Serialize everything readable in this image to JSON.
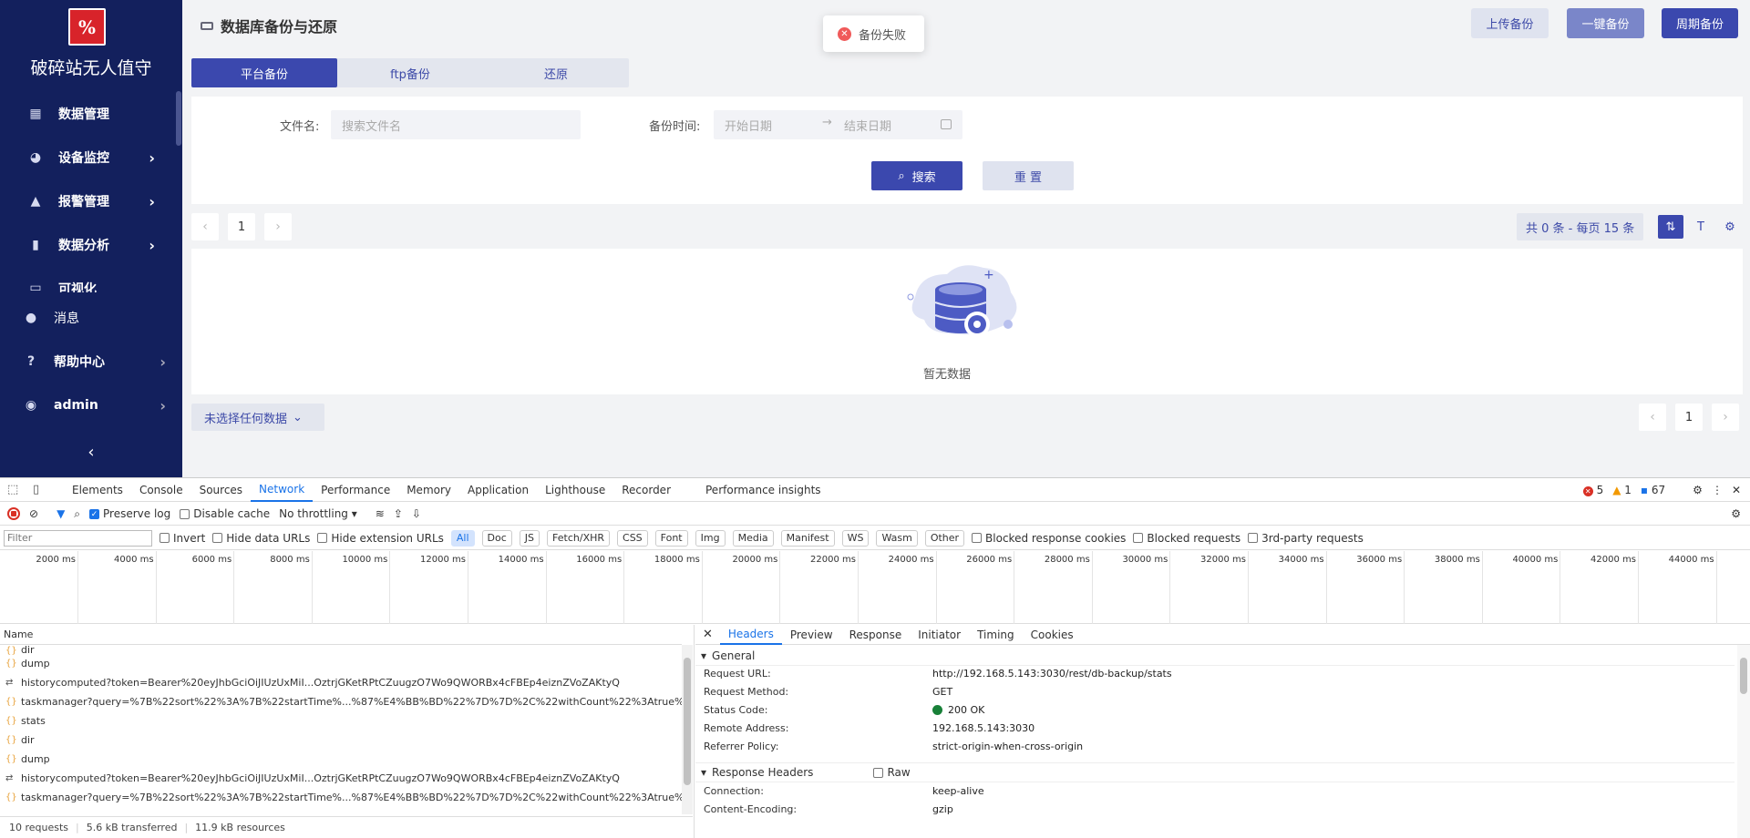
{
  "sidebar": {
    "logo_text": "%",
    "brand": "破碎站无人值守",
    "items": [
      {
        "label": "数据管理"
      },
      {
        "label": "设备监控"
      },
      {
        "label": "报警管理"
      },
      {
        "label": "数据分析"
      },
      {
        "label": "可视化"
      },
      {
        "label": "消息"
      },
      {
        "label": "帮助中心"
      },
      {
        "label": "admin"
      }
    ]
  },
  "header": {
    "title": "数据库备份与还原",
    "toast": "备份失败",
    "upload_label": "上传备份",
    "oneclick_label": "一键备份",
    "periodic_label": "周期备份"
  },
  "tabs": [
    "平台备份",
    "ftp备份",
    "还原"
  ],
  "search": {
    "filename_label": "文件名:",
    "filename_placeholder": "搜索文件名",
    "time_label": "备份时间:",
    "start_placeholder": "开始日期",
    "end_placeholder": "结束日期",
    "search_label": "搜索",
    "reset_label": "重 置"
  },
  "pager": {
    "page": "1",
    "total_text": "共 0 条 - 每页 15 条"
  },
  "table": {
    "empty_text": "暂无数据"
  },
  "selection": {
    "label": "未选择任何数据"
  },
  "devtools": {
    "tabs": [
      "Elements",
      "Console",
      "Sources",
      "Network",
      "Performance",
      "Memory",
      "Application",
      "Lighthouse",
      "Recorder",
      "Performance insights"
    ],
    "errors": "5",
    "warnings": "1",
    "messages": "67",
    "preserve_log": "Preserve log",
    "disable_cache": "Disable cache",
    "throttling": "No throttling",
    "filter_placeholder": "Filter",
    "invert": "Invert",
    "hide_data": "Hide data URLs",
    "hide_ext": "Hide extension URLs",
    "types": [
      "All",
      "Doc",
      "JS",
      "Fetch/XHR",
      "CSS",
      "Font",
      "Img",
      "Media",
      "Manifest",
      "WS",
      "Wasm",
      "Other"
    ],
    "blocked_cookies": "Blocked response cookies",
    "blocked_requests": "Blocked requests",
    "third_party": "3rd-party requests",
    "ticks": [
      "2000 ms",
      "4000 ms",
      "6000 ms",
      "8000 ms",
      "10000 ms",
      "12000 ms",
      "14000 ms",
      "16000 ms",
      "18000 ms",
      "20000 ms",
      "22000 ms",
      "24000 ms",
      "26000 ms",
      "28000 ms",
      "30000 ms",
      "32000 ms",
      "34000 ms",
      "36000 ms",
      "38000 ms",
      "40000 ms",
      "42000 ms",
      "44000 ms"
    ],
    "name_header": "Name",
    "requests": [
      {
        "type": "js",
        "name": "dir"
      },
      {
        "type": "js",
        "name": "dump"
      },
      {
        "type": "ws",
        "name": "historycomputed?token=Bearer%20eyJhbGciOiJIUzUxMiI...OztrjGKetRPtCZuugzO7Wo9QWORBx4cFBEp4eiznZVoZAKtyQ"
      },
      {
        "type": "js",
        "name": "taskmanager?query=%7B%22sort%22%3A%7B%22startTime%...%87%E4%BB%BD%22%7D%7D%2C%22withCount%22%3Atrue%7D"
      },
      {
        "type": "js",
        "name": "stats"
      },
      {
        "type": "js",
        "name": "dir"
      },
      {
        "type": "js",
        "name": "dump"
      },
      {
        "type": "ws",
        "name": "historycomputed?token=Bearer%20eyJhbGciOiJIUzUxMiI...OztrjGKetRPtCZuugzO7Wo9QWORBx4cFBEp4eiznZVoZAKtyQ"
      },
      {
        "type": "js",
        "name": "taskmanager?query=%7B%22sort%22%3A%7B%22startTime%...%87%E4%BB%BD%22%7D%7D%2C%22withCount%22%3Atrue%7D"
      }
    ],
    "status": {
      "requests": "10 requests",
      "transferred": "5.6 kB transferred",
      "resources": "11.9 kB resources"
    },
    "detail_tabs": [
      "Headers",
      "Preview",
      "Response",
      "Initiator",
      "Timing",
      "Cookies"
    ],
    "general_title": "General",
    "general": [
      {
        "k": "Request URL:",
        "v": "http://192.168.5.143:3030/rest/db-backup/stats"
      },
      {
        "k": "Request Method:",
        "v": "GET"
      },
      {
        "k": "Status Code:",
        "v": "200 OK"
      },
      {
        "k": "Remote Address:",
        "v": "192.168.5.143:3030"
      },
      {
        "k": "Referrer Policy:",
        "v": "strict-origin-when-cross-origin"
      }
    ],
    "response_headers_title": "Response Headers",
    "raw_label": "Raw",
    "response_headers": [
      {
        "k": "Connection:",
        "v": "keep-alive"
      },
      {
        "k": "Content-Encoding:",
        "v": "gzip"
      }
    ]
  },
  "colors": {
    "sidebar": "#13205d",
    "primary": "#3b48ae",
    "error": "#f05a5a"
  }
}
